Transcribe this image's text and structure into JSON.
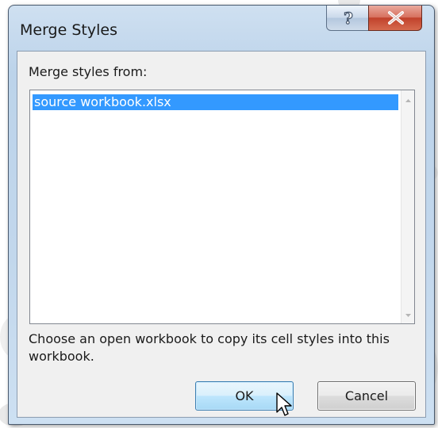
{
  "dialog": {
    "title": "Merge Styles",
    "help_icon": "help-icon",
    "close_icon": "close-icon"
  },
  "list": {
    "label": "Merge styles from:",
    "items": [
      "source workbook.xlsx"
    ],
    "selected_index": 0
  },
  "description": "Choose an open workbook to copy its cell styles into this workbook.",
  "buttons": {
    "ok": "OK",
    "cancel": "Cancel"
  },
  "colors": {
    "selection": "#3399ff",
    "close_button": "#c7432e",
    "ok_border": "#3c7fb1"
  }
}
